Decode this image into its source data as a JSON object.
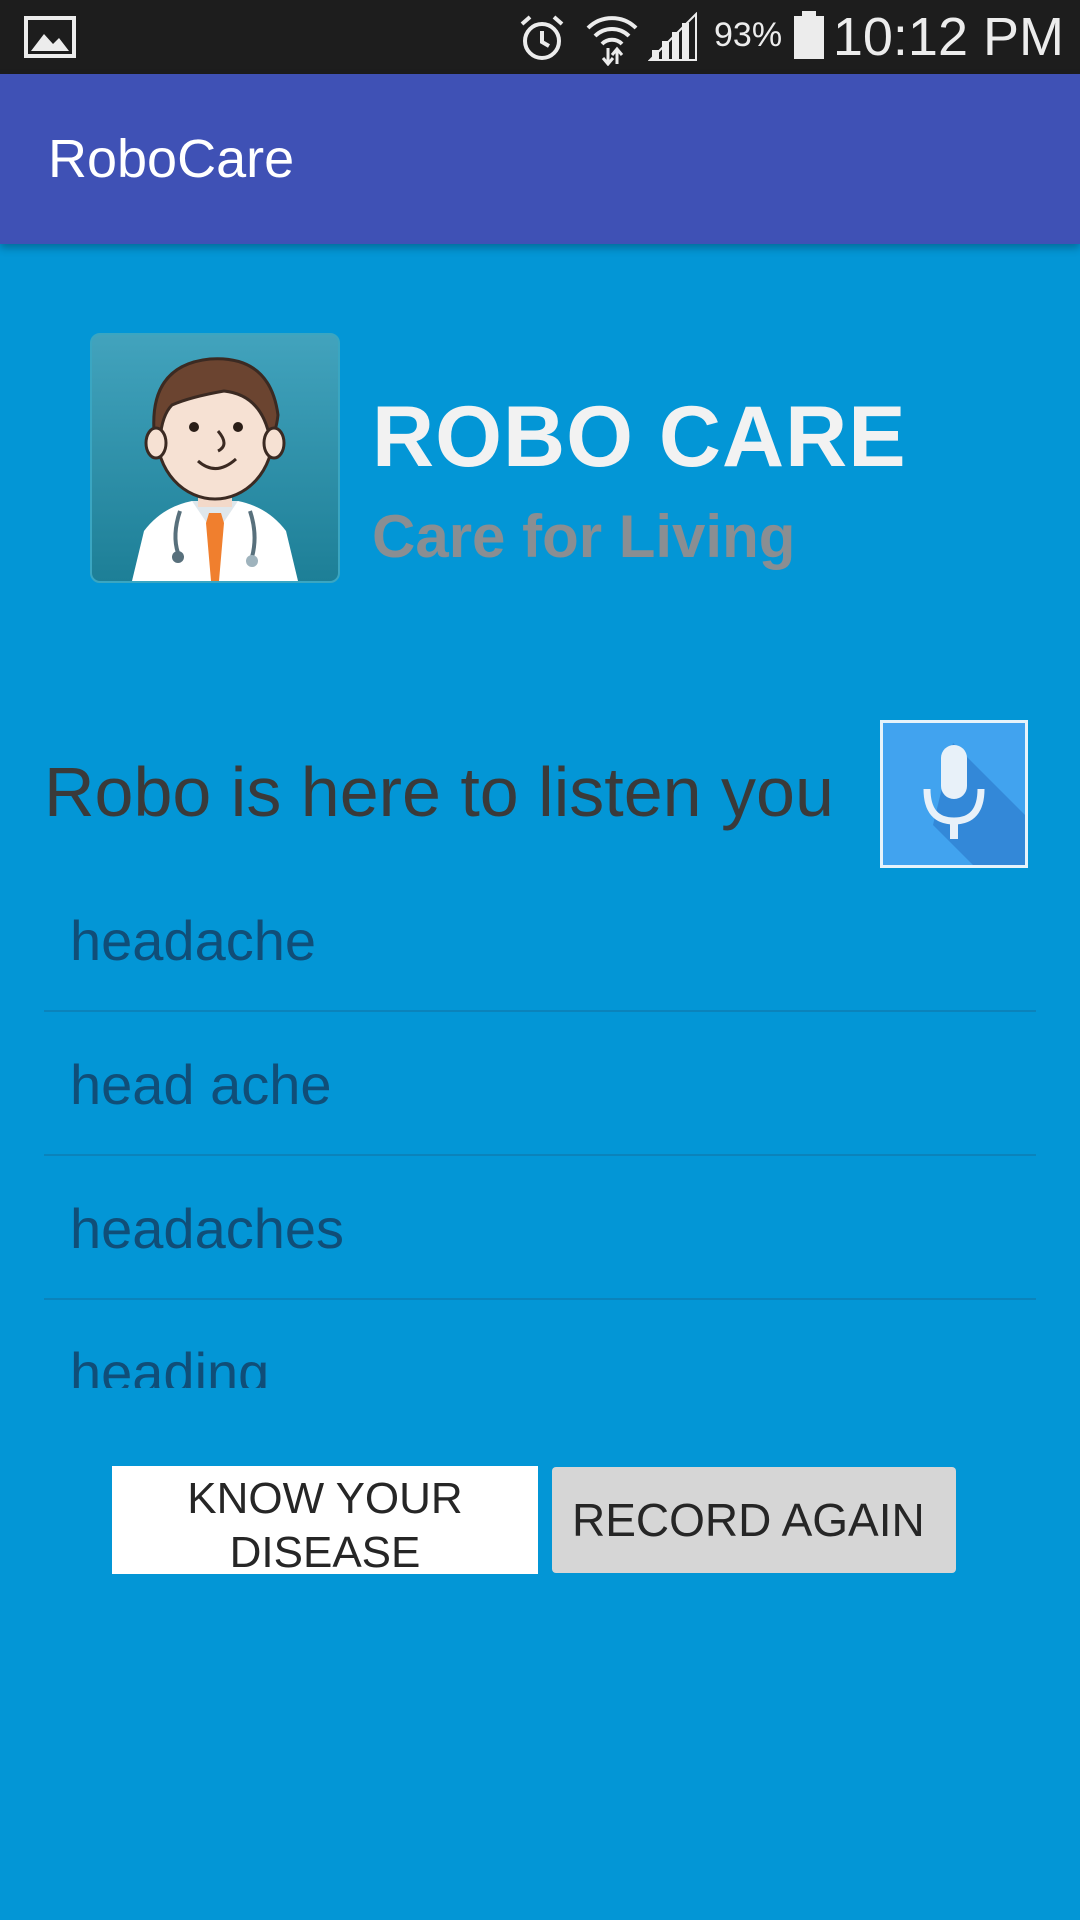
{
  "status_bar": {
    "battery_percent": "93%",
    "time": "10:12 PM",
    "icons": [
      "gallery-icon",
      "alarm-icon",
      "wifi-icon",
      "signal-icon",
      "battery-icon"
    ]
  },
  "app_bar": {
    "title": "RoboCare"
  },
  "header": {
    "brand_title": "ROBO CARE",
    "tagline": "Care for Living",
    "logo_icon": "doctor-avatar-icon"
  },
  "listen": {
    "prompt": "Robo is here to listen you",
    "mic_icon": "microphone-icon"
  },
  "results": [
    {
      "label": "headache"
    },
    {
      "label": "head ache"
    },
    {
      "label": "headaches"
    },
    {
      "label": "heading"
    }
  ],
  "buttons": {
    "know_line1": "KNOW YOUR",
    "know_line2": "DISEASE",
    "record_again": "RECORD AGAIN"
  },
  "colors": {
    "status_bar": "#1d1d1d",
    "app_bar": "#3f51b5",
    "background": "#0396d6",
    "tagline": "#8a8e92",
    "list_text": "#104e78",
    "mic_button": "#41a3ef"
  }
}
